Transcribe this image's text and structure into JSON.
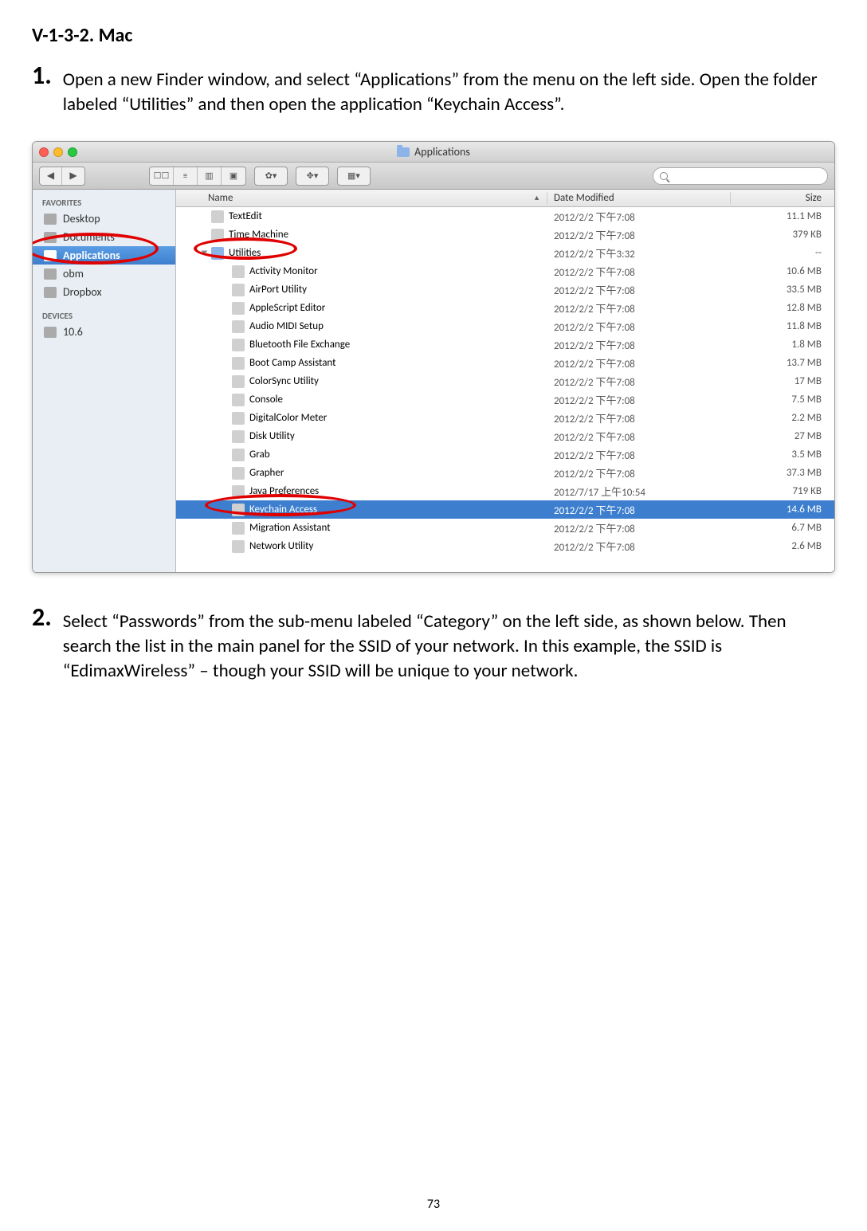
{
  "heading": "V-1-3-2.    Mac",
  "step1": {
    "num": "1.",
    "text": "Open a new Finder window, and select “Applications” from the menu on the left side. Open the folder labeled “Utilities” and then open the application “Keychain Access”."
  },
  "step2": {
    "num": "2.",
    "text": "Select “Passwords” from the sub-menu labeled “Category” on the left side, as shown below. Then search the list in the main panel for the SSID of your network. In this example, the SSID is “EdimaxWireless” – though your SSID will be unique to your network."
  },
  "finder": {
    "title": "Applications",
    "columns": {
      "name": "Name",
      "date": "Date Modified",
      "size": "Size"
    },
    "sidebar": {
      "favorites_header": "FAVORITES",
      "devices_header": "DEVICES",
      "items": [
        {
          "label": "Desktop"
        },
        {
          "label": "Documents"
        },
        {
          "label": "Applications",
          "selected": true
        },
        {
          "label": "obm"
        },
        {
          "label": "Dropbox"
        }
      ],
      "devices": [
        {
          "label": "10.6"
        }
      ]
    },
    "rows": [
      {
        "name": "TextEdit",
        "date": "2012/2/2 下午7:08",
        "size": "11.1 MB",
        "indent": false
      },
      {
        "name": "Time Machine",
        "date": "2012/2/2 下午7:08",
        "size": "379 KB",
        "indent": false
      },
      {
        "name": "Utilities",
        "date": "2012/2/2 下午3:32",
        "size": "--",
        "indent": false,
        "folder": true
      },
      {
        "name": "Activity Monitor",
        "date": "2012/2/2 下午7:08",
        "size": "10.6 MB",
        "indent": true
      },
      {
        "name": "AirPort Utility",
        "date": "2012/2/2 下午7:08",
        "size": "33.5 MB",
        "indent": true
      },
      {
        "name": "AppleScript Editor",
        "date": "2012/2/2 下午7:08",
        "size": "12.8 MB",
        "indent": true
      },
      {
        "name": "Audio MIDI Setup",
        "date": "2012/2/2 下午7:08",
        "size": "11.8 MB",
        "indent": true
      },
      {
        "name": "Bluetooth File Exchange",
        "date": "2012/2/2 下午7:08",
        "size": "1.8 MB",
        "indent": true
      },
      {
        "name": "Boot Camp Assistant",
        "date": "2012/2/2 下午7:08",
        "size": "13.7 MB",
        "indent": true
      },
      {
        "name": "ColorSync Utility",
        "date": "2012/2/2 下午7:08",
        "size": "17 MB",
        "indent": true
      },
      {
        "name": "Console",
        "date": "2012/2/2 下午7:08",
        "size": "7.5 MB",
        "indent": true
      },
      {
        "name": "DigitalColor Meter",
        "date": "2012/2/2 下午7:08",
        "size": "2.2 MB",
        "indent": true
      },
      {
        "name": "Disk Utility",
        "date": "2012/2/2 下午7:08",
        "size": "27 MB",
        "indent": true
      },
      {
        "name": "Grab",
        "date": "2012/2/2 下午7:08",
        "size": "3.5 MB",
        "indent": true
      },
      {
        "name": "Grapher",
        "date": "2012/2/2 下午7:08",
        "size": "37.3 MB",
        "indent": true
      },
      {
        "name": "Java Preferences",
        "date": "2012/7/17 上午10:54",
        "size": "719 KB",
        "indent": true
      },
      {
        "name": "Keychain Access",
        "date": "2012/2/2 下午7:08",
        "size": "14.6 MB",
        "indent": true,
        "selected": true
      },
      {
        "name": "Migration Assistant",
        "date": "2012/2/2 下午7:08",
        "size": "6.7 MB",
        "indent": true
      },
      {
        "name": "Network Utility",
        "date": "2012/2/2 下午7:08",
        "size": "2.6 MB",
        "indent": true
      }
    ]
  },
  "page_number": "73"
}
